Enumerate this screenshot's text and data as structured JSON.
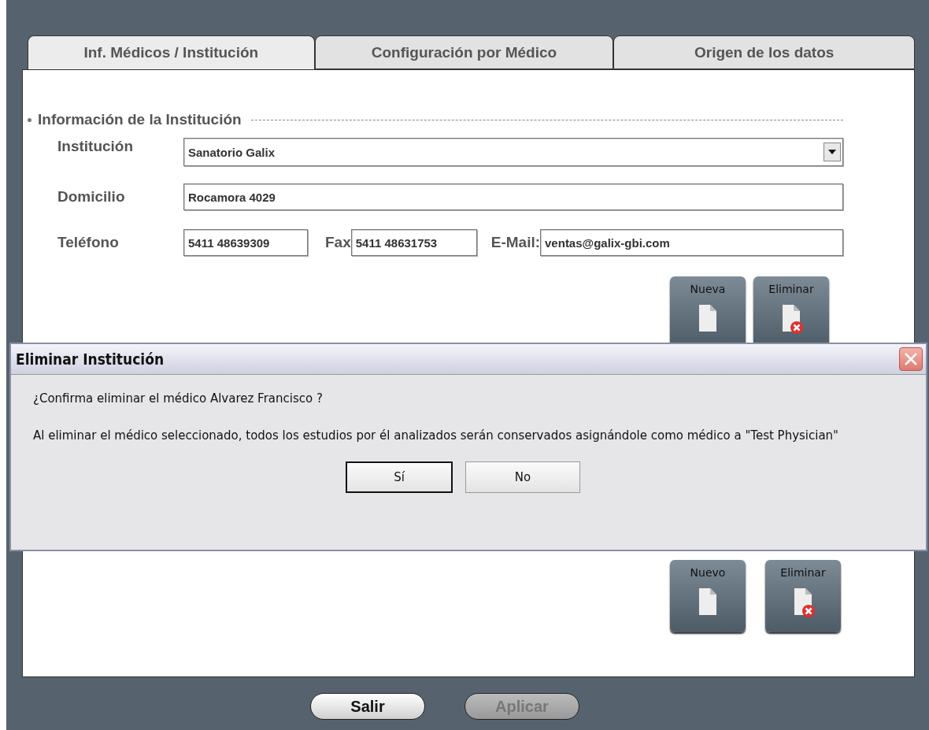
{
  "tabs": [
    {
      "label": "Inf. Médicos / Institución",
      "selected": true
    },
    {
      "label": "Configuración por Médico",
      "selected": false
    },
    {
      "label": "Origen de los datos",
      "selected": false
    }
  ],
  "section": {
    "title": "Información de la Institución"
  },
  "form": {
    "institution": {
      "label": "Institución",
      "value": "Sanatorio Galix"
    },
    "address": {
      "label": "Domicilio",
      "value": "Rocamora 4029"
    },
    "phone": {
      "label": "Teléfono",
      "value": "5411 48639309"
    },
    "fax": {
      "label": "Fax",
      "value": "5411 48631753"
    },
    "email": {
      "label": "E-Mail:",
      "value": "ventas@galix-gbi.com"
    }
  },
  "institution_buttons": [
    {
      "label": "Nueva",
      "kind": "new"
    },
    {
      "label": "Eliminar",
      "kind": "delete"
    }
  ],
  "physician_buttons": [
    {
      "label": "Nuevo",
      "kind": "new"
    },
    {
      "label": "Eliminar",
      "kind": "delete"
    }
  ],
  "dialog": {
    "title": "Eliminar Institución",
    "message": "¿Confirma eliminar el médico Alvarez Francisco ?",
    "detail": "Al eliminar el médico seleccionado, todos los estudios por él analizados serán conservados asignándole como médico a \"Test Physician\"",
    "buttons": [
      {
        "label": "Sí",
        "default": true
      },
      {
        "label": "No",
        "default": false
      }
    ]
  },
  "footer_buttons": [
    {
      "label": "Salir",
      "disabled": false
    },
    {
      "label": "Aplicar",
      "disabled": true
    }
  ]
}
